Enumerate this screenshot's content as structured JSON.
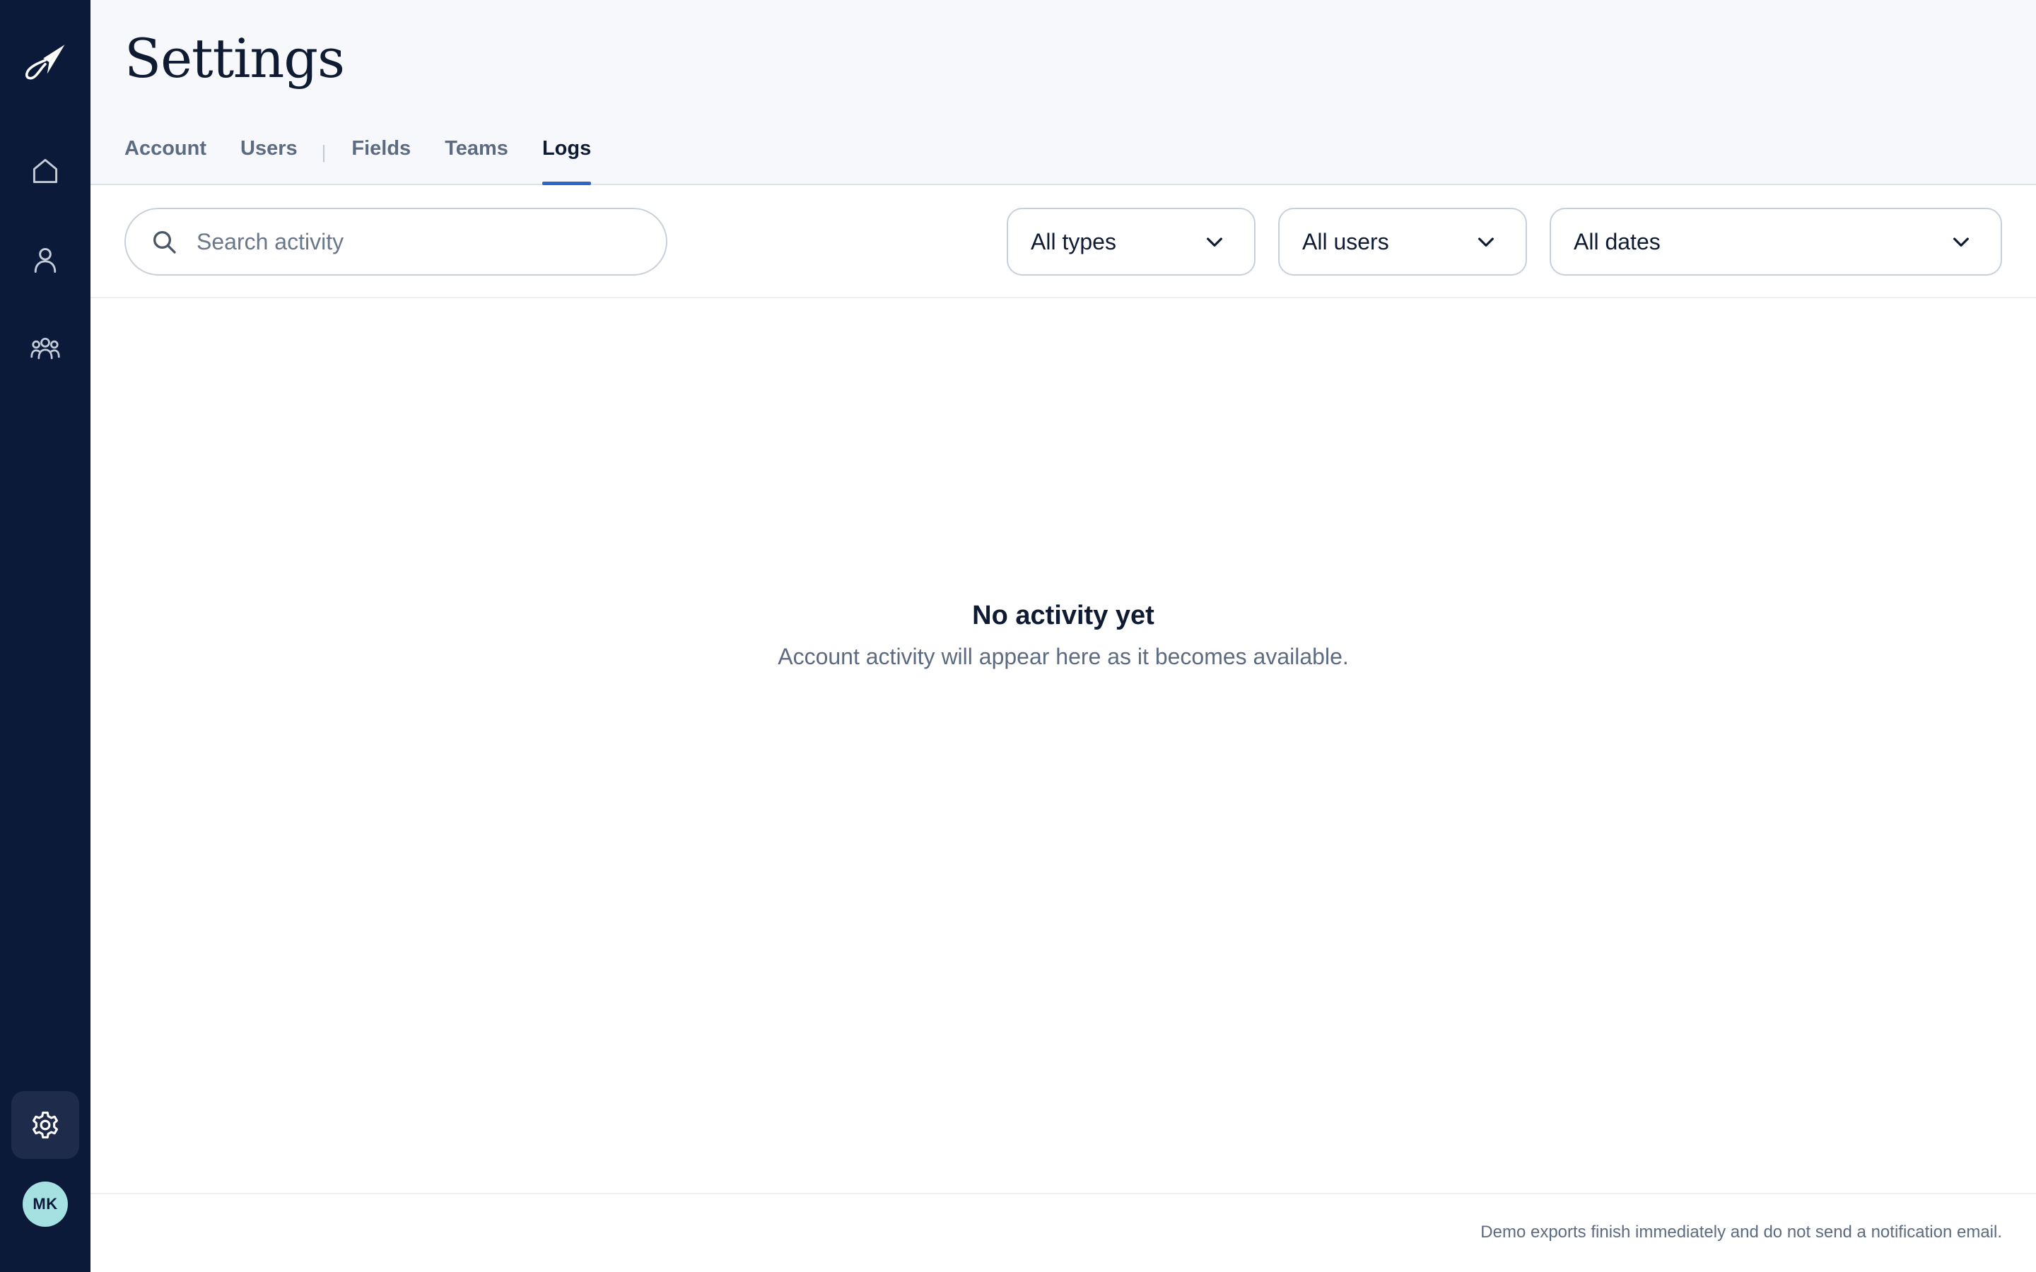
{
  "sidebar": {
    "logo_icon": "paper-plane-logo",
    "nav": [
      {
        "icon": "home-icon"
      },
      {
        "icon": "user-icon"
      },
      {
        "icon": "team-icon"
      }
    ],
    "settings_icon": "gear-icon",
    "avatar_initials": "MK"
  },
  "header": {
    "title": "Settings",
    "tabs": [
      {
        "label": "Account",
        "active": false
      },
      {
        "label": "Users",
        "active": false
      },
      {
        "label": "Fields",
        "active": false
      },
      {
        "label": "Teams",
        "active": false
      },
      {
        "label": "Logs",
        "active": true
      }
    ]
  },
  "filters": {
    "search_placeholder": "Search activity",
    "search_value": "",
    "type_select": "All types",
    "user_select": "All users",
    "date_select": "All dates"
  },
  "empty_state": {
    "title": "No activity yet",
    "subtitle": "Account activity will appear here as it becomes available."
  },
  "footer": {
    "note": "Demo exports finish immediately and do not send a notification email."
  },
  "colors": {
    "sidebar_bg": "#0c1a3a",
    "active_tab_underline": "#2f67c9",
    "avatar_bg": "#a6e1e1"
  }
}
